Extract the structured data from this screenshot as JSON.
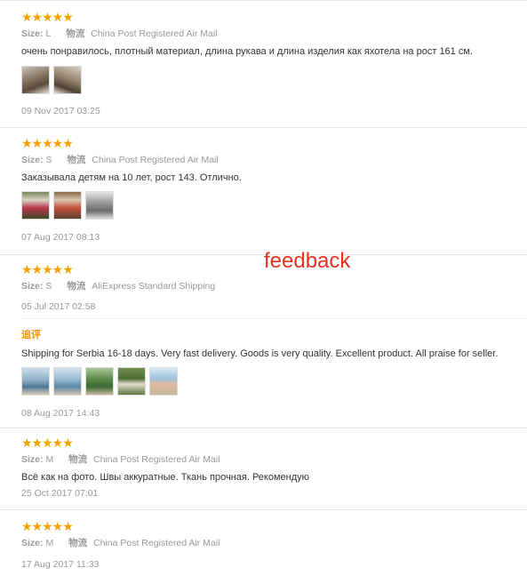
{
  "feedback_label": "feedback",
  "star_rating": 5,
  "reviews": [
    {
      "stars": "★★★★★",
      "size_label": "Size:",
      "size": "L",
      "ship_label": "物流",
      "shipping": "China Post Registered Air Mail",
      "text": "очень понравилось, плотный материал, длина рукава и длина изделия как яхотела на рост 161 см.",
      "date": "09 Nov 2017 03:25"
    },
    {
      "stars": "★★★★★",
      "size_label": "Size:",
      "size": "S",
      "ship_label": "物流",
      "shipping": "China Post Registered Air Mail",
      "text": "Заказывала детям на 10 лет, рост 143. Отлично.",
      "date": "07 Aug 2017 08:13"
    },
    {
      "stars": "★★★★★",
      "size_label": "Size:",
      "size": "S",
      "ship_label": "物流",
      "shipping": "AliExpress Standard Shipping",
      "date": "05 Jul 2017 02:58",
      "additional_label": "追评",
      "additional_text": "Shipping for Serbia 16-18 days. Very fast delivery. Goods is very quality. Excellent product. All praise for seller.",
      "additional_date": "08 Aug 2017 14:43"
    },
    {
      "stars": "★★★★★",
      "size_label": "Size:",
      "size": "M",
      "ship_label": "物流",
      "shipping": "China Post Registered Air Mail",
      "text": "Всё как на фото. Швы аккуратные. Ткань прочная. Рекомендую",
      "date": "25 Oct 2017 07:01"
    },
    {
      "stars": "★★★★★",
      "size_label": "Size:",
      "size": "M",
      "ship_label": "物流",
      "shipping": "China Post Registered Air Mail",
      "date": "17 Aug 2017 11:33"
    }
  ]
}
